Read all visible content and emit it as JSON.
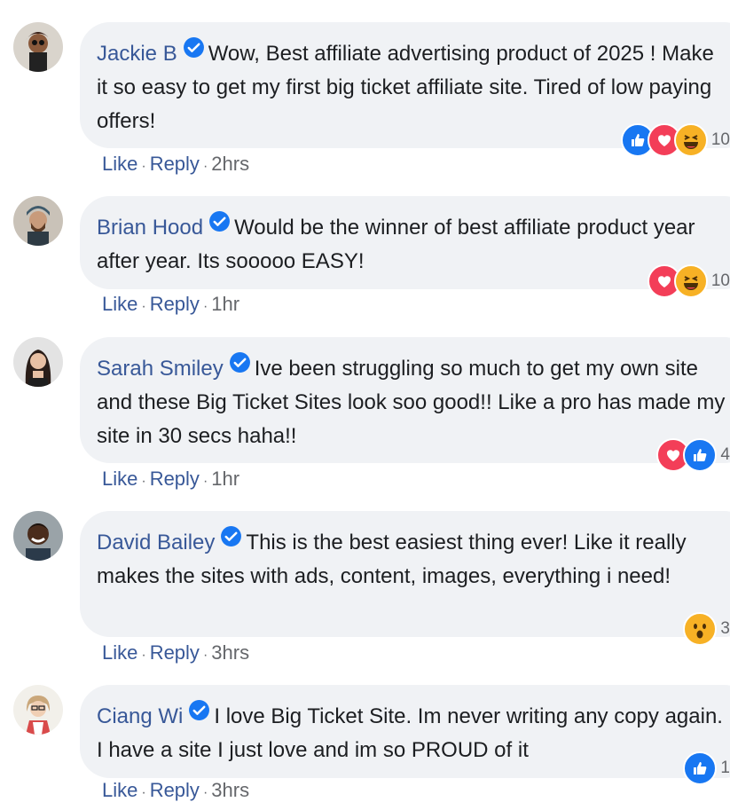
{
  "comments": [
    {
      "author": "Jackie B",
      "text": "Wow, Best affiliate advertising product of 2025 ! Make it so easy to get my first big ticket affiliate site. Tired of low paying offers!",
      "like": "Like",
      "reply": "Reply",
      "time": "2hrs",
      "reactions": [
        "like",
        "love",
        "haha"
      ],
      "reaction_count": "10"
    },
    {
      "author": "Brian Hood",
      "text": "Would be the winner of best affiliate product year after year. Its sooooo EASY!",
      "like": "Like",
      "reply": "Reply",
      "time": "1hr",
      "reactions": [
        "love",
        "haha"
      ],
      "reaction_count": "10"
    },
    {
      "author": "Sarah Smiley",
      "text": "Ive been struggling so much to get my own site and these Big Ticket Sites look soo good!! Like a pro has made my site in 30 secs haha!!",
      "like": "Like",
      "reply": "Reply",
      "time": "1hr",
      "reactions": [
        "love",
        "like"
      ],
      "reaction_count": "4"
    },
    {
      "author": "David Bailey",
      "text": "This is the best easiest thing ever! Like it really makes the sites with ads, content, images, everything i need!",
      "like": "Like",
      "reply": "Reply",
      "time": "3hrs",
      "reactions": [
        "wow"
      ],
      "reaction_count": "3"
    },
    {
      "author": "Ciang Wi",
      "text": "I love Big Ticket Site. Im never writing any copy again. I have a site I just love and im so PROUD of it",
      "like": "Like",
      "reply": "Reply",
      "time": "3hrs",
      "reactions": [
        "like"
      ],
      "reaction_count": "1"
    }
  ],
  "colors": {
    "name": "#385898",
    "bubble": "#f0f2f5",
    "verified": "#1877f2",
    "like": "#1877f2",
    "love": "#f33e58",
    "haha": "#f7b125"
  }
}
